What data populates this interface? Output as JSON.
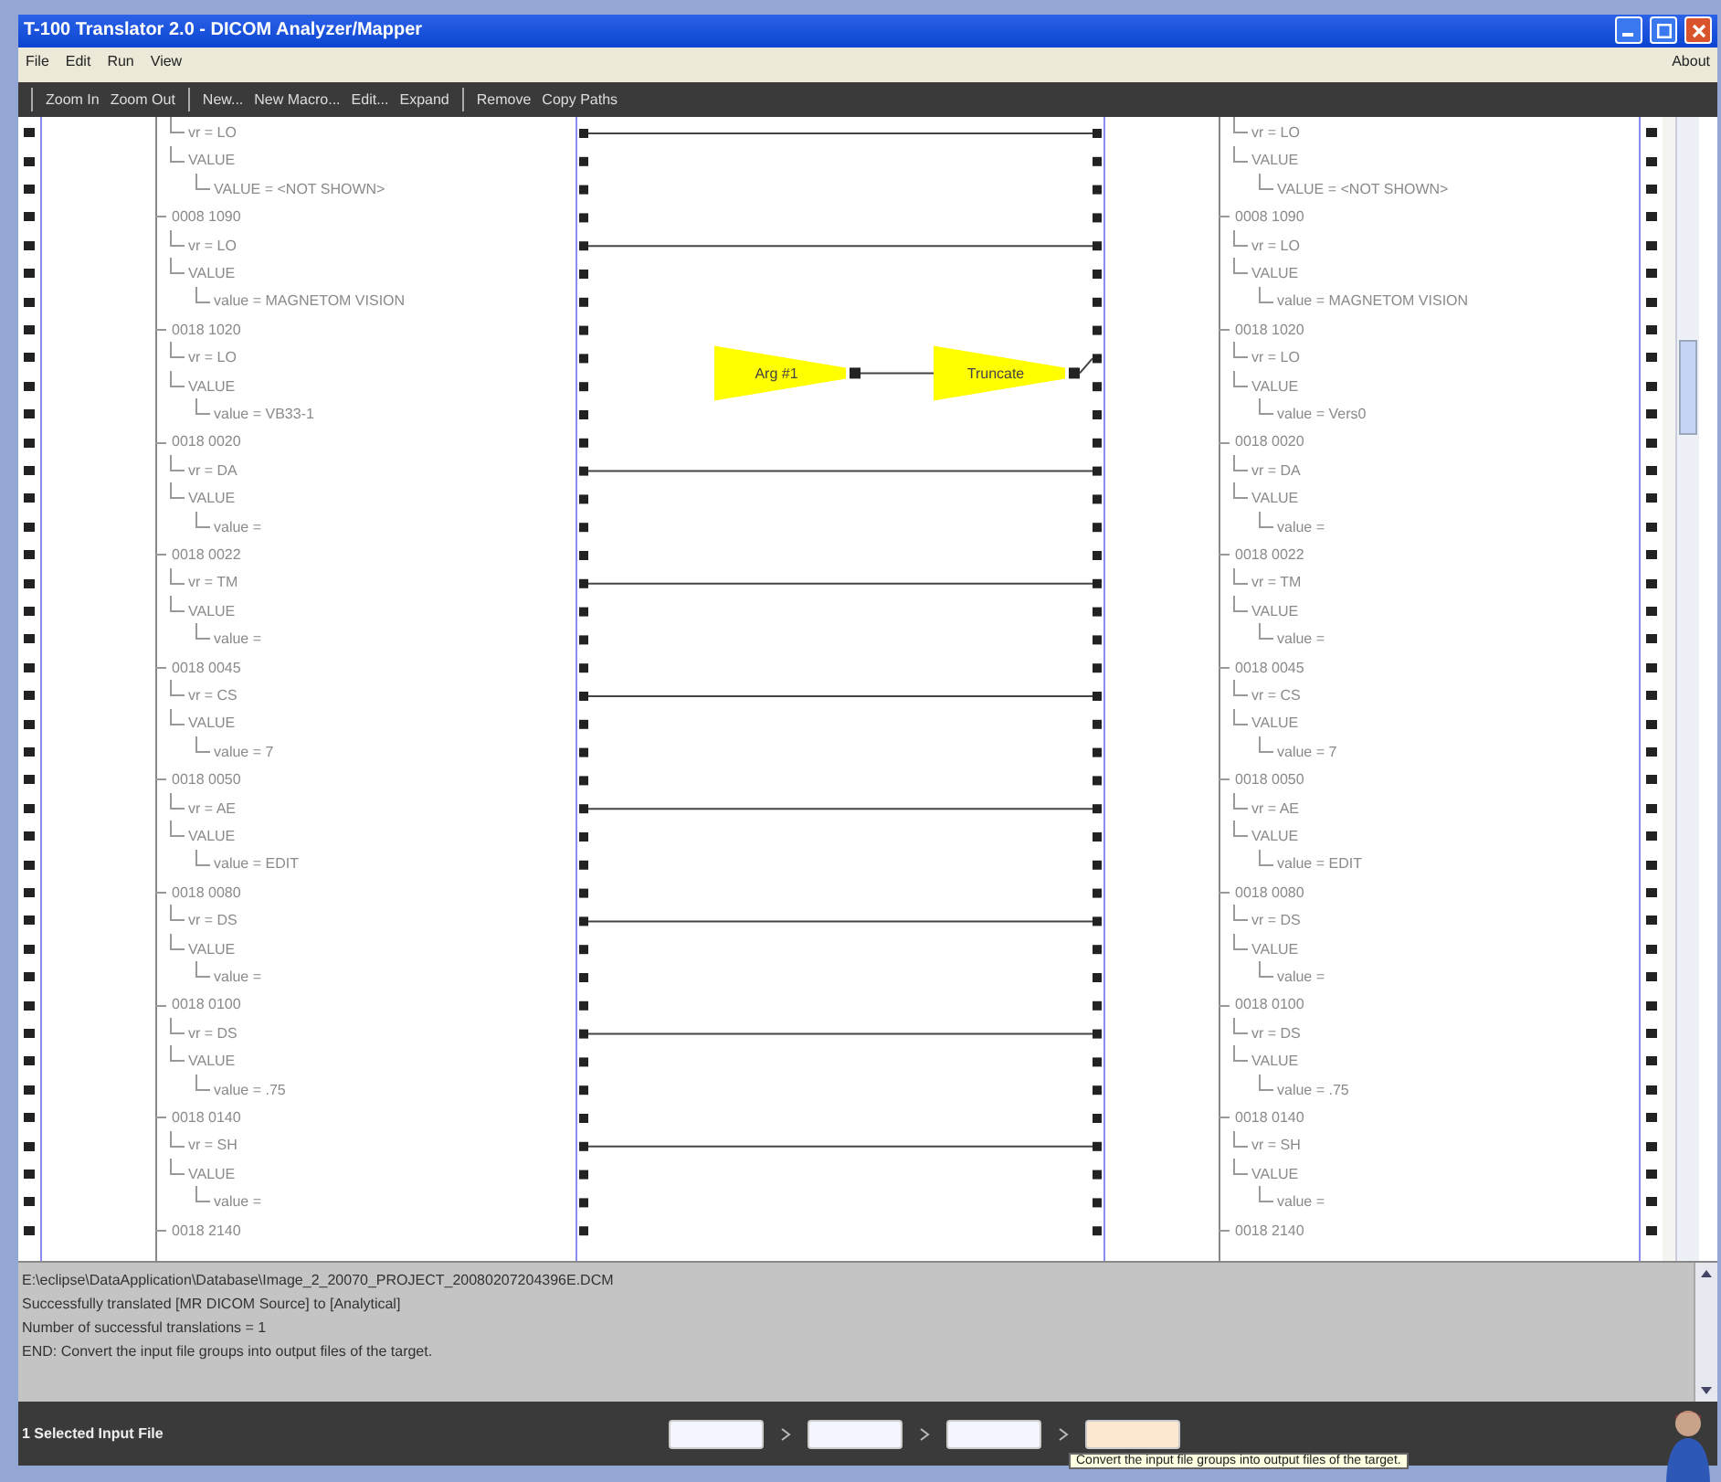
{
  "window": {
    "title": "T-100 Translator 2.0 - DICOM Analyzer/Mapper"
  },
  "menu": {
    "items": [
      "File",
      "Edit",
      "Run",
      "View"
    ],
    "right": "About"
  },
  "toolbar": {
    "groups": [
      [
        "Zoom In",
        "Zoom Out"
      ],
      [
        "New...",
        "New Macro...",
        "Edit...",
        "Expand"
      ],
      [
        "Remove",
        "Copy Paths"
      ]
    ]
  },
  "source_tree": [
    {
      "children": [
        {
          "label": "vr = LO"
        },
        {
          "label": "VALUE",
          "children": [
            {
              "label": "VALUE = <NOT SHOWN>"
            }
          ]
        }
      ],
      "mapping": {
        "kind": "line"
      }
    },
    {
      "label": "0008 1090",
      "children": [
        {
          "label": "vr = LO"
        },
        {
          "label": "VALUE",
          "children": [
            {
              "label": "value = MAGNETOM VISION"
            }
          ]
        }
      ],
      "mapping": {
        "kind": "line"
      }
    },
    {
      "label": "0018 1020",
      "children": [
        {
          "label": "vr = LO"
        },
        {
          "label": "VALUE",
          "children": [
            {
              "label": "value = VB33-1"
            }
          ]
        }
      ],
      "mapping": {
        "kind": "function",
        "functions": [
          {
            "label": "Arg #1"
          },
          {
            "label": "Truncate"
          }
        ]
      }
    },
    {
      "label": "0018 0020",
      "children": [
        {
          "label": "vr = DA"
        },
        {
          "label": "VALUE",
          "children": [
            {
              "label": "value ="
            }
          ]
        }
      ],
      "mapping": {
        "kind": "line"
      }
    },
    {
      "label": "0018 0022",
      "children": [
        {
          "label": "vr = TM"
        },
        {
          "label": "VALUE",
          "children": [
            {
              "label": "value ="
            }
          ]
        }
      ],
      "mapping": {
        "kind": "line"
      }
    },
    {
      "label": "0018 0045",
      "children": [
        {
          "label": "vr = CS"
        },
        {
          "label": "VALUE",
          "children": [
            {
              "label": "value = 7"
            }
          ]
        }
      ],
      "mapping": {
        "kind": "line"
      }
    },
    {
      "label": "0018 0050",
      "children": [
        {
          "label": "vr = AE"
        },
        {
          "label": "VALUE",
          "children": [
            {
              "label": "value = EDIT"
            }
          ]
        }
      ],
      "mapping": {
        "kind": "line"
      }
    },
    {
      "label": "0018 0080",
      "children": [
        {
          "label": "vr = DS"
        },
        {
          "label": "VALUE",
          "children": [
            {
              "label": "value ="
            }
          ]
        }
      ],
      "mapping": {
        "kind": "line"
      }
    },
    {
      "label": "0018 0100",
      "children": [
        {
          "label": "vr = DS"
        },
        {
          "label": "VALUE",
          "children": [
            {
              "label": "value = .75"
            }
          ]
        }
      ],
      "mapping": {
        "kind": "line"
      }
    },
    {
      "label": "0018 0140",
      "children": [
        {
          "label": "vr = SH"
        },
        {
          "label": "VALUE",
          "children": [
            {
              "label": "value ="
            }
          ]
        }
      ],
      "mapping": {
        "kind": "line"
      }
    },
    {
      "label": "0018 2140"
    }
  ],
  "target_tree": [
    {
      "children": [
        {
          "label": "vr = LO"
        },
        {
          "label": "VALUE",
          "children": [
            {
              "label": "VALUE = <NOT SHOWN>"
            }
          ]
        }
      ]
    },
    {
      "label": "0008 1090",
      "children": [
        {
          "label": "vr = LO"
        },
        {
          "label": "VALUE",
          "children": [
            {
              "label": "value = MAGNETOM VISION"
            }
          ]
        }
      ]
    },
    {
      "label": "0018 1020",
      "children": [
        {
          "label": "vr = LO"
        },
        {
          "label": "VALUE",
          "children": [
            {
              "label": "value = Vers0"
            }
          ]
        }
      ]
    },
    {
      "label": "0018 0020",
      "children": [
        {
          "label": "vr = DA"
        },
        {
          "label": "VALUE",
          "children": [
            {
              "label": "value ="
            }
          ]
        }
      ]
    },
    {
      "label": "0018 0022",
      "children": [
        {
          "label": "vr = TM"
        },
        {
          "label": "VALUE",
          "children": [
            {
              "label": "value ="
            }
          ]
        }
      ]
    },
    {
      "label": "0018 0045",
      "children": [
        {
          "label": "vr = CS"
        },
        {
          "label": "VALUE",
          "children": [
            {
              "label": "value = 7"
            }
          ]
        }
      ]
    },
    {
      "label": "0018 0050",
      "children": [
        {
          "label": "vr = AE"
        },
        {
          "label": "VALUE",
          "children": [
            {
              "label": "value = EDIT"
            }
          ]
        }
      ]
    },
    {
      "label": "0018 0080",
      "children": [
        {
          "label": "vr = DS"
        },
        {
          "label": "VALUE",
          "children": [
            {
              "label": "value ="
            }
          ]
        }
      ]
    },
    {
      "label": "0018 0100",
      "children": [
        {
          "label": "vr = DS"
        },
        {
          "label": "VALUE",
          "children": [
            {
              "label": "value = .75"
            }
          ]
        }
      ]
    },
    {
      "label": "0018 0140",
      "children": [
        {
          "label": "vr = SH"
        },
        {
          "label": "VALUE",
          "children": [
            {
              "label": "value ="
            }
          ]
        }
      ]
    },
    {
      "label": "0018 2140"
    }
  ],
  "log": [
    "E:\\eclipse\\DataApplication\\Database\\Image_2_20070_PROJECT_20080207204396E.DCM",
    "Successfully translated [MR DICOM Source] to [Analytical]",
    "Number of successful translations = 1",
    "END:  Convert the input file groups into output files of the target."
  ],
  "action_bar": {
    "status": "1 Selected Input File",
    "buttons": [
      {
        "hovered": false
      },
      {
        "hovered": false
      },
      {
        "hovered": false
      },
      {
        "hovered": true
      }
    ],
    "tooltip": "Convert the input file groups into output files of the target."
  }
}
